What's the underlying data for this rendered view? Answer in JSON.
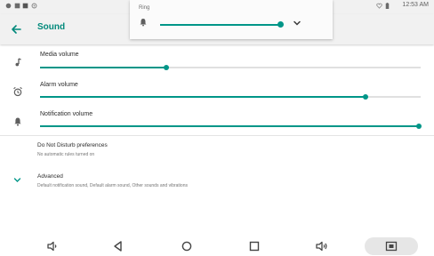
{
  "status_bar": {
    "time": "12:53 AM",
    "left_icons": [
      "circle-icon",
      "square-icon",
      "square-icon",
      "gear-icon"
    ],
    "right_icons": [
      "heart-icon",
      "battery-icon"
    ]
  },
  "app_bar": {
    "title": "Sound",
    "back_icon": "arrow-left-icon"
  },
  "ring_popup": {
    "label": "Ring",
    "icon": "bell-icon",
    "level": 0.96,
    "expand_icon": "chevron-down-icon"
  },
  "volumes": [
    {
      "label": "Media volume",
      "icon": "music-note-icon",
      "level": 0.33
    },
    {
      "label": "Alarm volume",
      "icon": "alarm-clock-icon",
      "level": 0.86
    },
    {
      "label": "Notification volume",
      "icon": "bell-icon",
      "level": 1.0
    }
  ],
  "dnd": {
    "title": "Do Not Disturb preferences",
    "subtitle": "No automatic rules turned on"
  },
  "advanced": {
    "title": "Advanced",
    "subtitle": "Default notification sound, Default alarm sound, Other sounds and vibrations",
    "icon": "chevron-down-icon"
  },
  "nav_bar": {
    "buttons": [
      "volume-down-icon",
      "back-triangle-icon",
      "home-circle-icon",
      "recents-square-icon",
      "volume-up-icon",
      "screenshot-icon"
    ]
  },
  "colors": {
    "accent": "#009688",
    "title": "#00897b",
    "bar_bg": "#f1f1f1"
  }
}
